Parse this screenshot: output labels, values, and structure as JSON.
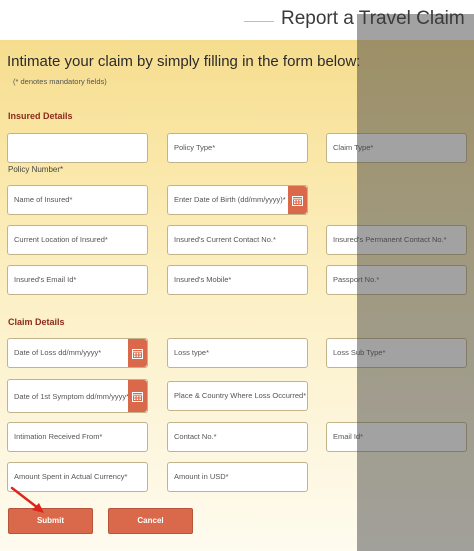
{
  "header": {
    "title": "Report a Travel Claim"
  },
  "intro": {
    "heading": "Intimate your claim by simply filling in the form below:",
    "mandatory_note": "(* denotes mandatory fields)"
  },
  "insured_details": {
    "title": "Insured Details",
    "policy_number_label": "Policy Number*",
    "fields": {
      "policy_number": "",
      "policy_type": "Policy Type*",
      "claim_type": "Claim Type*",
      "name_of_insured": "Name of Insured*",
      "date_of_birth": "Enter Date of Birth (dd/mm/yyyy)*",
      "current_location": "Current Location of Insured*",
      "current_contact": "Insured's Current Contact No.*",
      "permanent_contact": "Insured's Permanent Contact No.*",
      "email": "Insured's Email Id*",
      "mobile": "Insured's Mobile*",
      "passport": "Passport No.*"
    }
  },
  "claim_details": {
    "title": "Claim Details",
    "fields": {
      "date_of_loss": "Date of Loss dd/mm/yyyy*",
      "loss_type": "Loss type*",
      "loss_sub_type": "Loss Sub Type*",
      "date_first_symptom": "Date of 1st Symptom dd/mm/yyyy*",
      "place_country": "Place & Country Where Loss Occurred*",
      "intimation_received_from": "Intimation Received From*",
      "contact_no": "Contact No.*",
      "email_id": "Email Id*",
      "amount_actual_currency": "Amount Spent in Actual Currency*",
      "amount_usd": "Amount in USD*"
    }
  },
  "actions": {
    "submit_label": "Submit",
    "cancel_label": "Cancel"
  },
  "icons": {
    "calendar": "calendar-icon",
    "arrow": "red-arrow-icon"
  },
  "colors": {
    "accent": "#d9694a",
    "section_title": "#8c2a1b",
    "panel_top": "#f6dd8e",
    "panel_bottom": "#fefbef",
    "overlay": "#3c3c3c",
    "arrow": "#e0241b"
  }
}
